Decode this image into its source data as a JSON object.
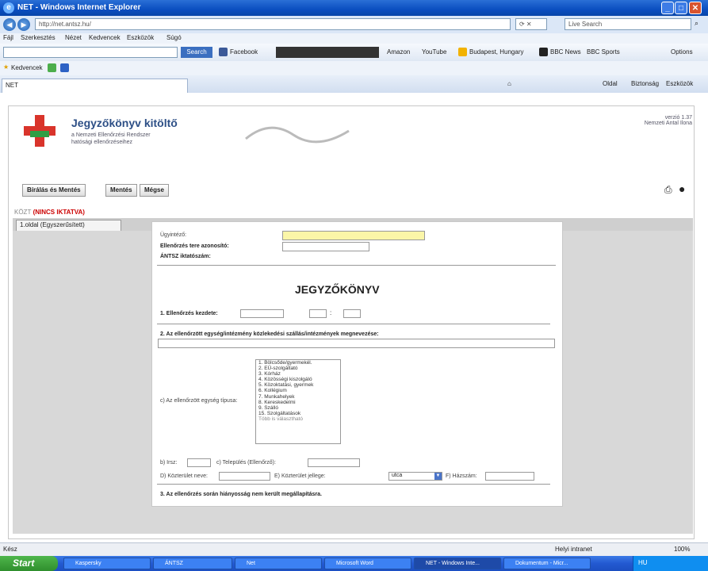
{
  "window": {
    "title": "NET - Windows Internet Explorer"
  },
  "address_bar": {
    "url": "http://net.antsz.hu/",
    "search_placeholder": "Live Search"
  },
  "menu": [
    "Fájl",
    "Szerkesztés",
    "Nézet",
    "Kedvencek",
    "Eszközök",
    "Súgó"
  ],
  "toolbar": {
    "search_label": "Search",
    "items": [
      "Facebook",
      "Amazon",
      "YouTube",
      "Budapest, Hungary",
      "BBC News",
      "BBC Sports"
    ],
    "options": "Options"
  },
  "favorites": {
    "label": "Kedvencek"
  },
  "tab": {
    "title": "NET"
  },
  "command_bar": {
    "items": [
      "Oldal",
      "Biztonság",
      "Eszközök"
    ]
  },
  "app": {
    "title": "Jegyzőkönyv kitöltő",
    "subtitle_line1": "a Nemzeti Ellenőrzési Rendszer",
    "subtitle_line2": "hatósági ellenőrzéseihez",
    "version": "verzió 1.37",
    "user": "Nemzeti Antal Ilona",
    "buttons": [
      "Bírálás és Mentés",
      "Mentés",
      "Mégse"
    ],
    "warning_prefix": "KÖZT",
    "warning": "(NINCS IKTATVA)",
    "tab": "1.oldal (Egyszerűsített)"
  },
  "form": {
    "field1_label": "Ügyintéző:",
    "field2_label": "Ellenőrzés tere azonosító:",
    "field3_label": "ÁNTSZ iktatószám:",
    "heading": "JEGYZŐKÖNYV",
    "section1": "1. Ellenőrzés kezdete:",
    "section2": "2. Az ellenőrzött egység/intézmény közlekedési szállás/intézmények megnevezése:",
    "listbox_label": "c) Az ellenőrzött egység típusa:",
    "list_items": [
      "1. Bölcsőde/gyermekél.",
      "2. EÜ-szolgáltató",
      "3. Kórház",
      "4. Közösségi kiszolgáló",
      "5. Közoktatási, gyermek",
      "6. Kollégium",
      "7. Munkahelyek",
      "8. Kereskedelmi",
      "9. Szálló",
      "15. Szolgáltatások"
    ],
    "list_note": "Több is választható",
    "row1_labels": [
      "b) Irsz:",
      "c) Település (Ellenőrző):"
    ],
    "row2_labels": [
      "D) Közterület neve:",
      "E) Közterület jellege:",
      "F) Házszám:"
    ],
    "street_type_value": "utca",
    "section3": "3. Az ellenőrzés során hiányosság nem került megállapításra."
  },
  "status_bar": {
    "zone": "Helyi intranet",
    "zoom": "100%"
  },
  "taskbar": {
    "start": "Start",
    "items": [
      "Kaspersky",
      "ÁNTSZ",
      "Net",
      "Microsoft Word",
      "NET - Windows Inte...",
      "Dokumentum - Micr..."
    ],
    "clock": "HU"
  }
}
